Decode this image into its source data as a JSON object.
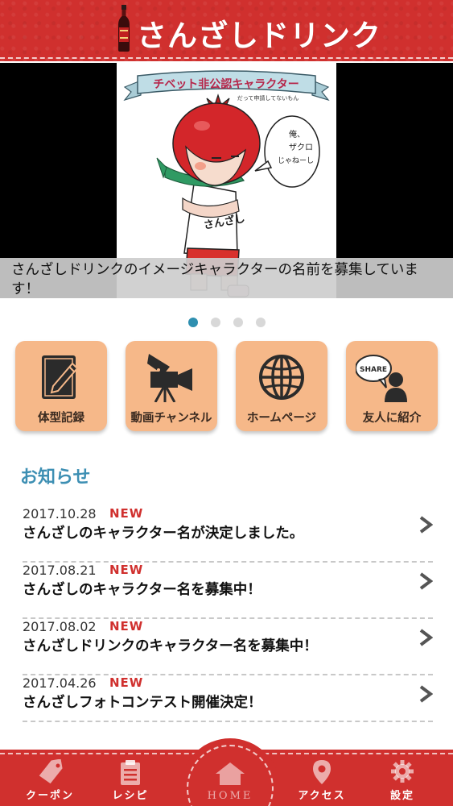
{
  "header": {
    "title": "さんざしドリンク",
    "logo_icon": "drink-bottle-icon"
  },
  "banner": {
    "art_ribbon": "チベット非公認キャラクター",
    "art_subtitle": "だって申請してないもん",
    "art_speech": [
      "俺、",
      "ザクロ",
      "じゃねーし"
    ],
    "art_shirt": "さんざし",
    "caption": "さんざしドリンクのイメージキャラクターの名前を募集しています！",
    "slide_count": 4,
    "active_slide": 0
  },
  "menu": [
    {
      "label": "体型記録",
      "icon": "notebook-pencil-icon"
    },
    {
      "label": "動画チャンネル",
      "icon": "video-camera-icon"
    },
    {
      "label": "ホームページ",
      "icon": "globe-icon"
    },
    {
      "label": "友人に紹介",
      "icon": "share-person-icon",
      "icon_text": "SHARE"
    }
  ],
  "news": {
    "title": "お知らせ",
    "items": [
      {
        "date": "2017.10.28",
        "badge": "NEW",
        "headline": "さんざしのキャラクター名が決定しました。"
      },
      {
        "date": "2017.08.21",
        "badge": "NEW",
        "headline": "さんざしのキャラクター名を募集中！"
      },
      {
        "date": "2017.08.02",
        "badge": "NEW",
        "headline": "さんざしドリンクのキャラクター名を募集中！"
      },
      {
        "date": "2017.04.26",
        "badge": "NEW",
        "headline": "さんざしフォトコンテスト開催決定！"
      }
    ]
  },
  "tabbar": [
    {
      "label": "クーポン",
      "icon": "coupon-tag-icon"
    },
    {
      "label": "レシピ",
      "icon": "clipboard-icon"
    },
    {
      "label": "HOME",
      "icon": "house-icon"
    },
    {
      "label": "アクセス",
      "icon": "map-pin-icon"
    },
    {
      "label": "設定",
      "icon": "gear-icon"
    }
  ],
  "colors": {
    "brand_red": "#d0302e",
    "tile_orange": "#f6b889",
    "accent_blue": "#3d8fb3",
    "badge_red": "#d0302e"
  }
}
